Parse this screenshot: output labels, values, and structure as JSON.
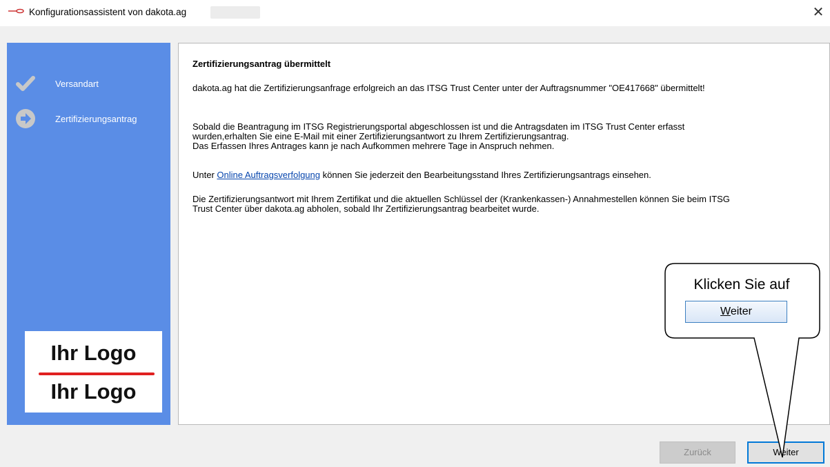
{
  "window": {
    "title": "Konfigurationsassistent von dakota.ag",
    "close_glyph": "✕"
  },
  "sidebar": {
    "steps": [
      {
        "label": "Versandart",
        "icon": "checkmark-icon",
        "state": "done"
      },
      {
        "label": "Zertifizierungsantrag",
        "icon": "arrow-right-circle-icon",
        "state": "current"
      }
    ],
    "logo": {
      "line1": "Ihr Logo",
      "line2": "Ihr Logo"
    }
  },
  "content": {
    "title": "Zertifizierungsantrag übermittelt",
    "p1": "dakota.ag hat die Zertifizierungsanfrage erfolgreich an das ITSG Trust Center unter der Auftragsnummer \"OE417668\" übermittelt!",
    "p2_line1": "Sobald die Beantragung im ITSG Registrierungsportal abgeschlossen ist und die Antragsdaten im ITSG Trust Center erfasst",
    "p2_line2": "wurden,erhalten Sie eine E-Mail mit einer Zertifizierungsantwort zu Ihrem Zertifizierungsantrag.",
    "p2_line3": "Das Erfassen Ihres Antrages kann je nach Aufkommen mehrere Tage in Anspruch nehmen.",
    "p3_before": "Unter ",
    "p3_link": "Online Auftragsverfolgung",
    "p3_after": " können Sie jederzeit den Bearbeitungsstand Ihres Zertifizierungsantrags einsehen.",
    "p4_line1": "Die Zertifizierungsantwort mit Ihrem Zertifikat und die aktuellen Schlüssel der (Krankenkassen-) Annahmestellen können Sie beim ITSG",
    "p4_line2": "Trust Center über dakota.ag abholen, sobald Ihr Zertifizierungsantrag bearbeitet wurde."
  },
  "buttons": {
    "back": "Zurück",
    "next": "Weiter"
  },
  "callout": {
    "text": "Klicken Sie auf",
    "button_underlined": "W",
    "button_rest": "eiter"
  },
  "colors": {
    "sidebar": "#5a8de6",
    "accent": "#0078d7",
    "link": "#0645ad",
    "logo_bar": "#e02020"
  }
}
